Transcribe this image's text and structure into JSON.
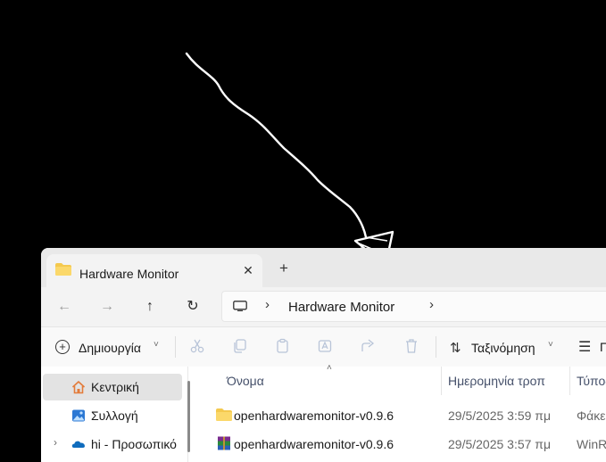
{
  "tab": {
    "title": "Hardware Monitor",
    "close_glyph": "✕",
    "new_tab_glyph": "+"
  },
  "nav": {
    "back_glyph": "←",
    "forward_glyph": "→",
    "up_glyph": "↑",
    "refresh_glyph": "↻",
    "breadcrumb_sep": "›",
    "breadcrumb": "Hardware Monitor"
  },
  "toolbar": {
    "new_label": "Δημιουργία",
    "sort_label": "Ταξινόμηση",
    "view_label": "Π",
    "caret": "˅",
    "sort_glyph": "⇅",
    "view_glyph": "☰",
    "plus_glyph": "+",
    "icons": [
      "cut-icon",
      "copy-icon",
      "paste-icon",
      "rename-icon",
      "share-icon",
      "delete-icon"
    ]
  },
  "sidebar": {
    "items": [
      {
        "label": "Κεντρική",
        "icon": "home-icon",
        "selected": true
      },
      {
        "label": "Συλλογή",
        "icon": "gallery-icon",
        "selected": false
      },
      {
        "label": "hi - Προσωπικό",
        "icon": "onedrive-icon",
        "selected": false,
        "expand": "›"
      }
    ]
  },
  "columns": {
    "name": "Όνομα",
    "date": "Ημερομηνία τροπ",
    "type": "Τύπος",
    "sort_glyph": "˄"
  },
  "files": [
    {
      "name": "openhardwaremonitor-v0.9.6",
      "date": "29/5/2025 3:59 πμ",
      "type": "Φάκε",
      "icon": "folder-icon"
    },
    {
      "name": "openhardwaremonitor-v0.9.6",
      "date": "29/5/2025 3:57 πμ",
      "type": "WinR",
      "icon": "winrar-archive-icon"
    }
  ],
  "colors": {
    "accent": "#0067c0",
    "folder": "#f4c94e",
    "selected": "#e3e3e3"
  }
}
